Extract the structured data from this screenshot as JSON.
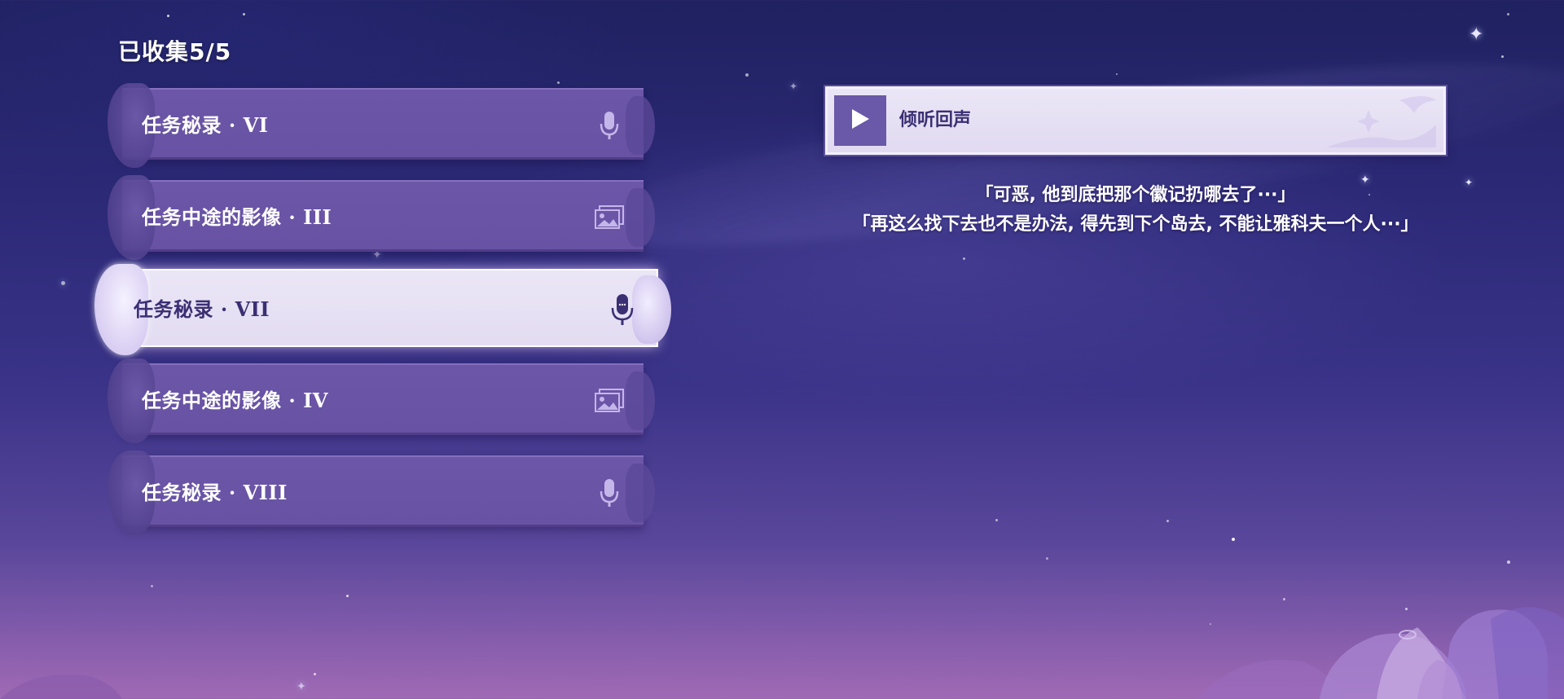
{
  "header": {
    "collected": "已收集5/5"
  },
  "records": [
    {
      "label": "任务秘录 · VI",
      "icon": "microphone-icon",
      "selected": false
    },
    {
      "label": "任务中途的影像 · III",
      "icon": "image-icon",
      "selected": false
    },
    {
      "label": "任务秘录 · VII",
      "icon": "microphone-icon",
      "selected": true
    },
    {
      "label": "任务中途的影像 · IV",
      "icon": "image-icon",
      "selected": false
    },
    {
      "label": "任务秘录 · VIII",
      "icon": "microphone-icon",
      "selected": false
    }
  ],
  "player": {
    "label": "倾听回声",
    "icon": "play-icon"
  },
  "transcript": {
    "line1": "「可恶, 他到底把那个徽记扔哪去了···」",
    "line2": "「再这么找下去也不是办法, 得先到下个岛去, 不能让雅科夫一个人···」"
  },
  "colors": {
    "item_bg": "#6a55a6",
    "item_active_bg": "#e8e2f5",
    "active_text": "#3b2f73",
    "play_button": "#6a58a8"
  }
}
